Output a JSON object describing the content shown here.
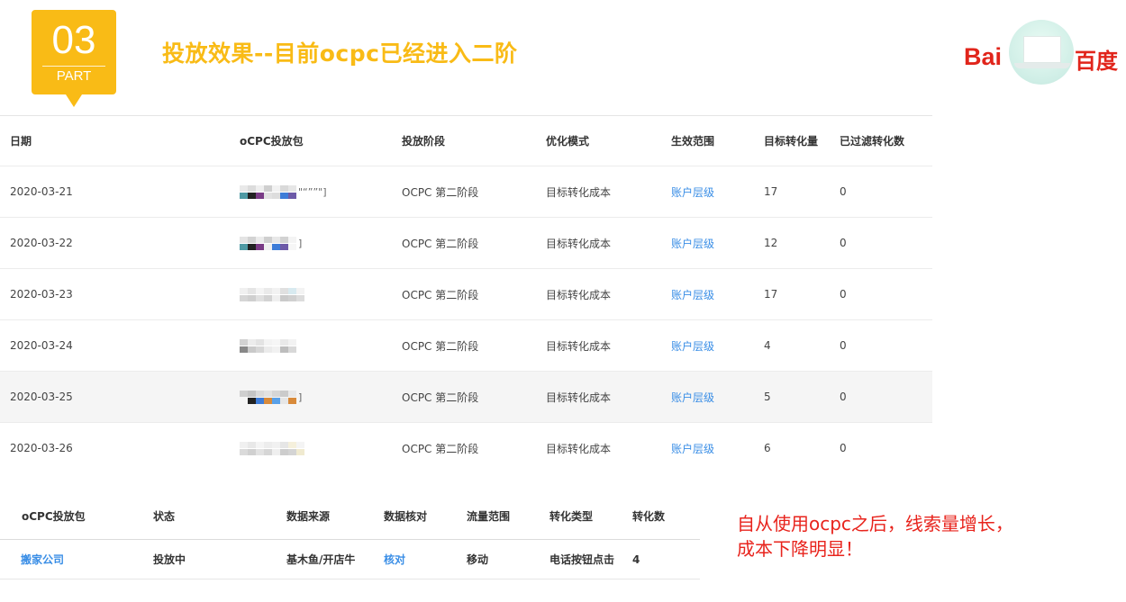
{
  "header": {
    "part_number": "03",
    "part_label": "PART",
    "title": "投放效果--目前ocpc已经进入二阶",
    "logo": {
      "latin": "Bai",
      "chinese": "百度",
      "icon": "laptop-icon"
    }
  },
  "main_table": {
    "columns": [
      "日期",
      "oCPC投放包",
      "投放阶段",
      "优化模式",
      "生效范围",
      "目标转化量",
      "已过滤转化数"
    ],
    "rows": [
      {
        "date": "2020-03-21",
        "package": "\"“””\"]",
        "stage": "OCPC 第二阶段",
        "mode": "目标转化成本",
        "scope": "账户层级",
        "target": "17",
        "filtered": "0"
      },
      {
        "date": "2020-03-22",
        "package": "]",
        "stage": "OCPC 第二阶段",
        "mode": "目标转化成本",
        "scope": "账户层级",
        "target": "12",
        "filtered": "0"
      },
      {
        "date": "2020-03-23",
        "package": "",
        "stage": "OCPC 第二阶段",
        "mode": "目标转化成本",
        "scope": "账户层级",
        "target": "17",
        "filtered": "0"
      },
      {
        "date": "2020-03-24",
        "package": "",
        "stage": "OCPC 第二阶段",
        "mode": "目标转化成本",
        "scope": "账户层级",
        "target": "4",
        "filtered": "0"
      },
      {
        "date": "2020-03-25",
        "package": "]",
        "stage": "OCPC 第二阶段",
        "mode": "目标转化成本",
        "scope": "账户层级",
        "target": "5",
        "filtered": "0"
      },
      {
        "date": "2020-03-26",
        "package": "",
        "stage": "OCPC 第二阶段",
        "mode": "目标转化成本",
        "scope": "账户层级",
        "target": "6",
        "filtered": "0"
      }
    ]
  },
  "sub_table": {
    "columns": [
      "oCPC投放包",
      "状态",
      "数据来源",
      "数据核对",
      "流量范围",
      "转化类型",
      "转化数"
    ],
    "row": {
      "package": "搬家公司",
      "status": "投放中",
      "source": "基木鱼/开店牛",
      "verify": "核对",
      "traffic": "移动",
      "conv_type": "电话按钮点击",
      "conv_count": "4"
    }
  },
  "note": {
    "line1": "自从使用ocpc之后，线索量增长，",
    "line2": "成本下降明显！"
  },
  "colors": {
    "accent": "#f9bb16",
    "link": "#3a8ee6",
    "note": "#e8241d",
    "brand": "#e1251b"
  }
}
